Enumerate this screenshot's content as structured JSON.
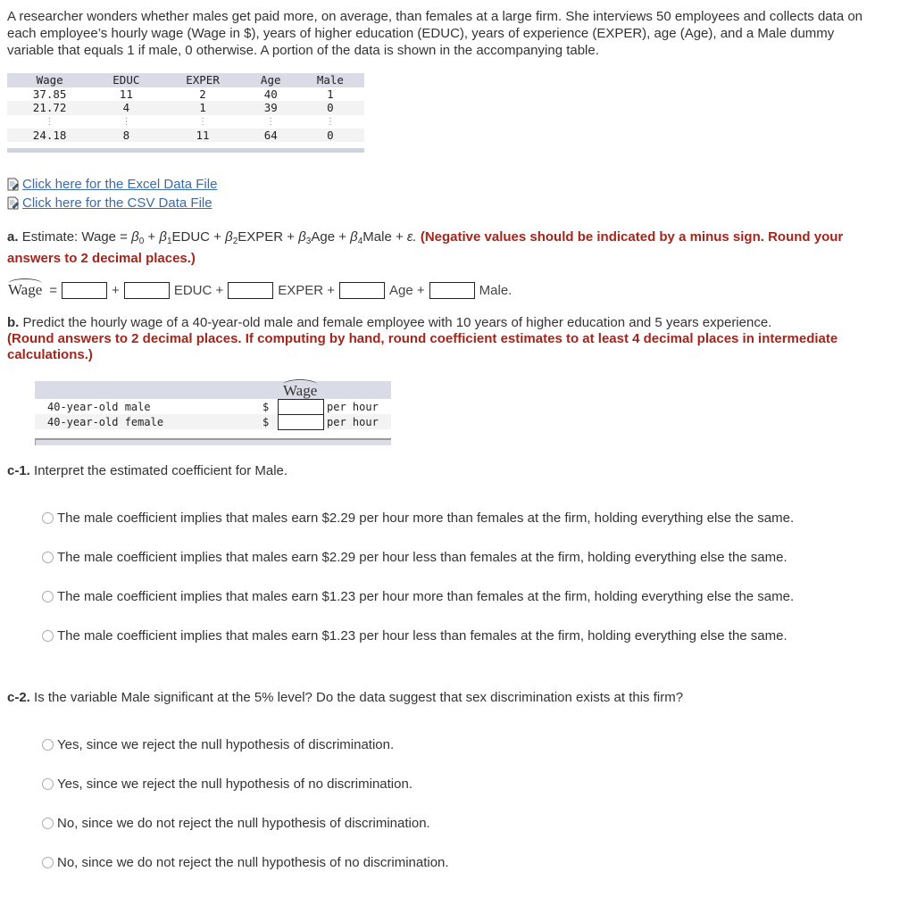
{
  "intro": "A researcher wonders whether males get paid more, on average, than females at a large firm. She interviews 50 employees and collects data on each employee’s hourly wage (Wage in $), years of higher education (EDUC), years of experience (EXPER), age (Age), and a Male dummy variable that equals 1 if male, 0 otherwise. A portion of the data is shown in the accompanying table.",
  "data_table": {
    "headers": [
      "Wage",
      "EDUC",
      "EXPER",
      "Age",
      "Male"
    ],
    "rows": [
      [
        "37.85",
        "11",
        "2",
        "40",
        "1"
      ],
      [
        "21.72",
        "4",
        "1",
        "39",
        "0"
      ],
      [
        "⋮",
        "⋮",
        "⋮",
        "⋮",
        "⋮"
      ],
      [
        "24.18",
        "8",
        "11",
        "64",
        "0"
      ]
    ]
  },
  "links": {
    "excel": "Click here for the Excel Data File",
    "csv": "Click here for the CSV Data File"
  },
  "part_a": {
    "label": "a.",
    "text_prefix": "Estimate: Wage = ",
    "beta": "β",
    "subs": [
      "0",
      "1",
      "2",
      "3",
      "4"
    ],
    "terms": [
      " + ",
      "EDUC + ",
      "EXPER + ",
      "Age + ",
      "Male + "
    ],
    "epsilon": "ε.",
    "instruction": "(Negative values should be indicated by a minus sign. Round your answers to 2 decimal places.)",
    "equation": {
      "lhs": "Wage",
      "equals": "=",
      "terms": [
        "+",
        "EDUC +",
        "EXPER +",
        "Age +",
        "Male."
      ],
      "values": [
        "",
        "",
        "",
        "",
        ""
      ]
    }
  },
  "part_b": {
    "label": "b.",
    "text": "Predict the hourly wage of a 40-year-old male and female employee with 10 years of higher education and 5 years experience.",
    "instruction": "(Round answers to 2 decimal places. If computing by hand, round coefficient estimates to at least 4 decimal places in intermediate calculations.)",
    "table": {
      "header": "Wage",
      "rows": [
        {
          "label": "40-year-old male",
          "currency": "$",
          "value": "",
          "unit": "per hour"
        },
        {
          "label": "40-year-old female",
          "currency": "$",
          "value": "",
          "unit": "per hour"
        }
      ]
    }
  },
  "part_c1": {
    "label": "c-1.",
    "text": "Interpret the estimated coefficient for Male.",
    "options": [
      "The male coefficient implies that males earn $2.29 per hour more than females at the firm, holding everything else the same.",
      "The male coefficient implies that males earn $2.29 per hour less than females at the firm, holding everything else the same.",
      "The male coefficient implies that males earn $1.23 per hour more than females at the firm, holding everything else the same.",
      "The male coefficient implies that males earn $1.23 per hour less than females at the firm, holding everything else the same."
    ]
  },
  "part_c2": {
    "label": "c-2.",
    "text": "Is the variable Male significant at the 5% level? Do the data suggest that sex discrimination exists at this firm?",
    "options": [
      "Yes, since we reject the null hypothesis of discrimination.",
      "Yes, since we reject the null hypothesis of no discrimination.",
      "No, since we do not reject the null hypothesis of discrimination.",
      "No, since we do not reject the null hypothesis of no discrimination."
    ]
  },
  "colors": {
    "link": "#3b6aa8",
    "instruction_red": "#a3261c",
    "table_header": "#d9dbe6"
  }
}
